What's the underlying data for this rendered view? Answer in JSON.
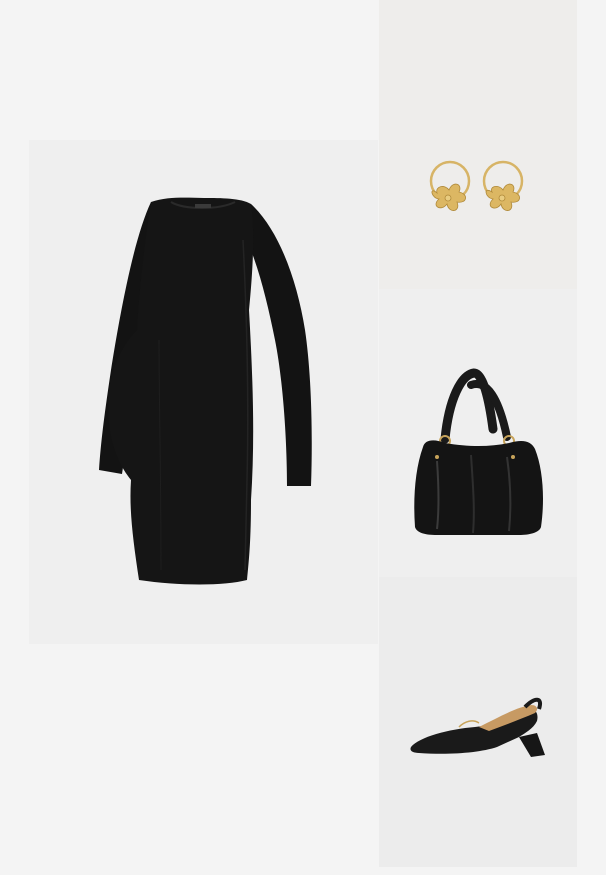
{
  "outfit": {
    "items": [
      {
        "name": "dress"
      },
      {
        "name": "earrings"
      },
      {
        "name": "handbag"
      },
      {
        "name": "slingback-heels"
      }
    ],
    "colors": {
      "page_bg": "#f4f4f4",
      "tile_bg": "#efefef",
      "garment_black": "#141414",
      "gold": "#d8b25e"
    }
  }
}
